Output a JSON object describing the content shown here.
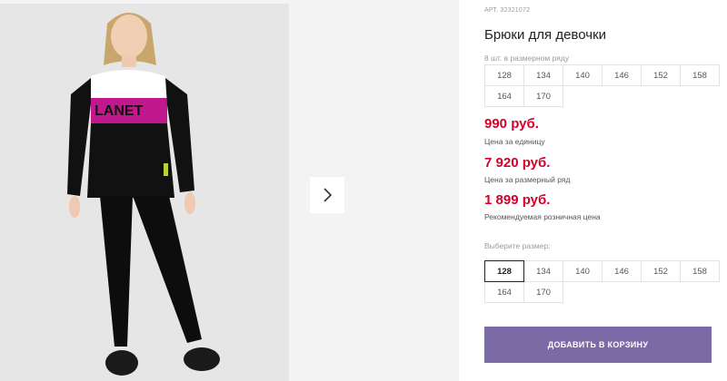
{
  "product": {
    "sku": "АРТ. 32321072",
    "title": "Брюки для девочки",
    "image_alt": "Girl wearing black leggings and black-white long sleeve top with pink PLANET print",
    "shirt_print": "LANET"
  },
  "pack": {
    "note": "8 шт. в размерном ряду",
    "sizes": [
      "128",
      "134",
      "140",
      "146",
      "152",
      "158",
      "164",
      "170"
    ]
  },
  "prices": {
    "unit_price": "990 руб.",
    "unit_label": "Цена за единицу",
    "pack_price": "7 920 руб.",
    "pack_label": "Цена за размерный ряд",
    "retail_price": "1 899 руб.",
    "retail_label": "Рекомендуемая розничная цена"
  },
  "size_select": {
    "label": "Выберите размер:",
    "selected": "128",
    "sizes": [
      "128",
      "134",
      "140",
      "146",
      "152",
      "158",
      "164",
      "170"
    ]
  },
  "actions": {
    "add_to_cart": "ДОБАВИТЬ В КОРЗИНУ"
  },
  "gallery": {
    "next_icon": "chevron-right-icon"
  },
  "colors": {
    "price": "#d7002a",
    "button": "#7b6aa6",
    "selected_border": "#222222"
  }
}
